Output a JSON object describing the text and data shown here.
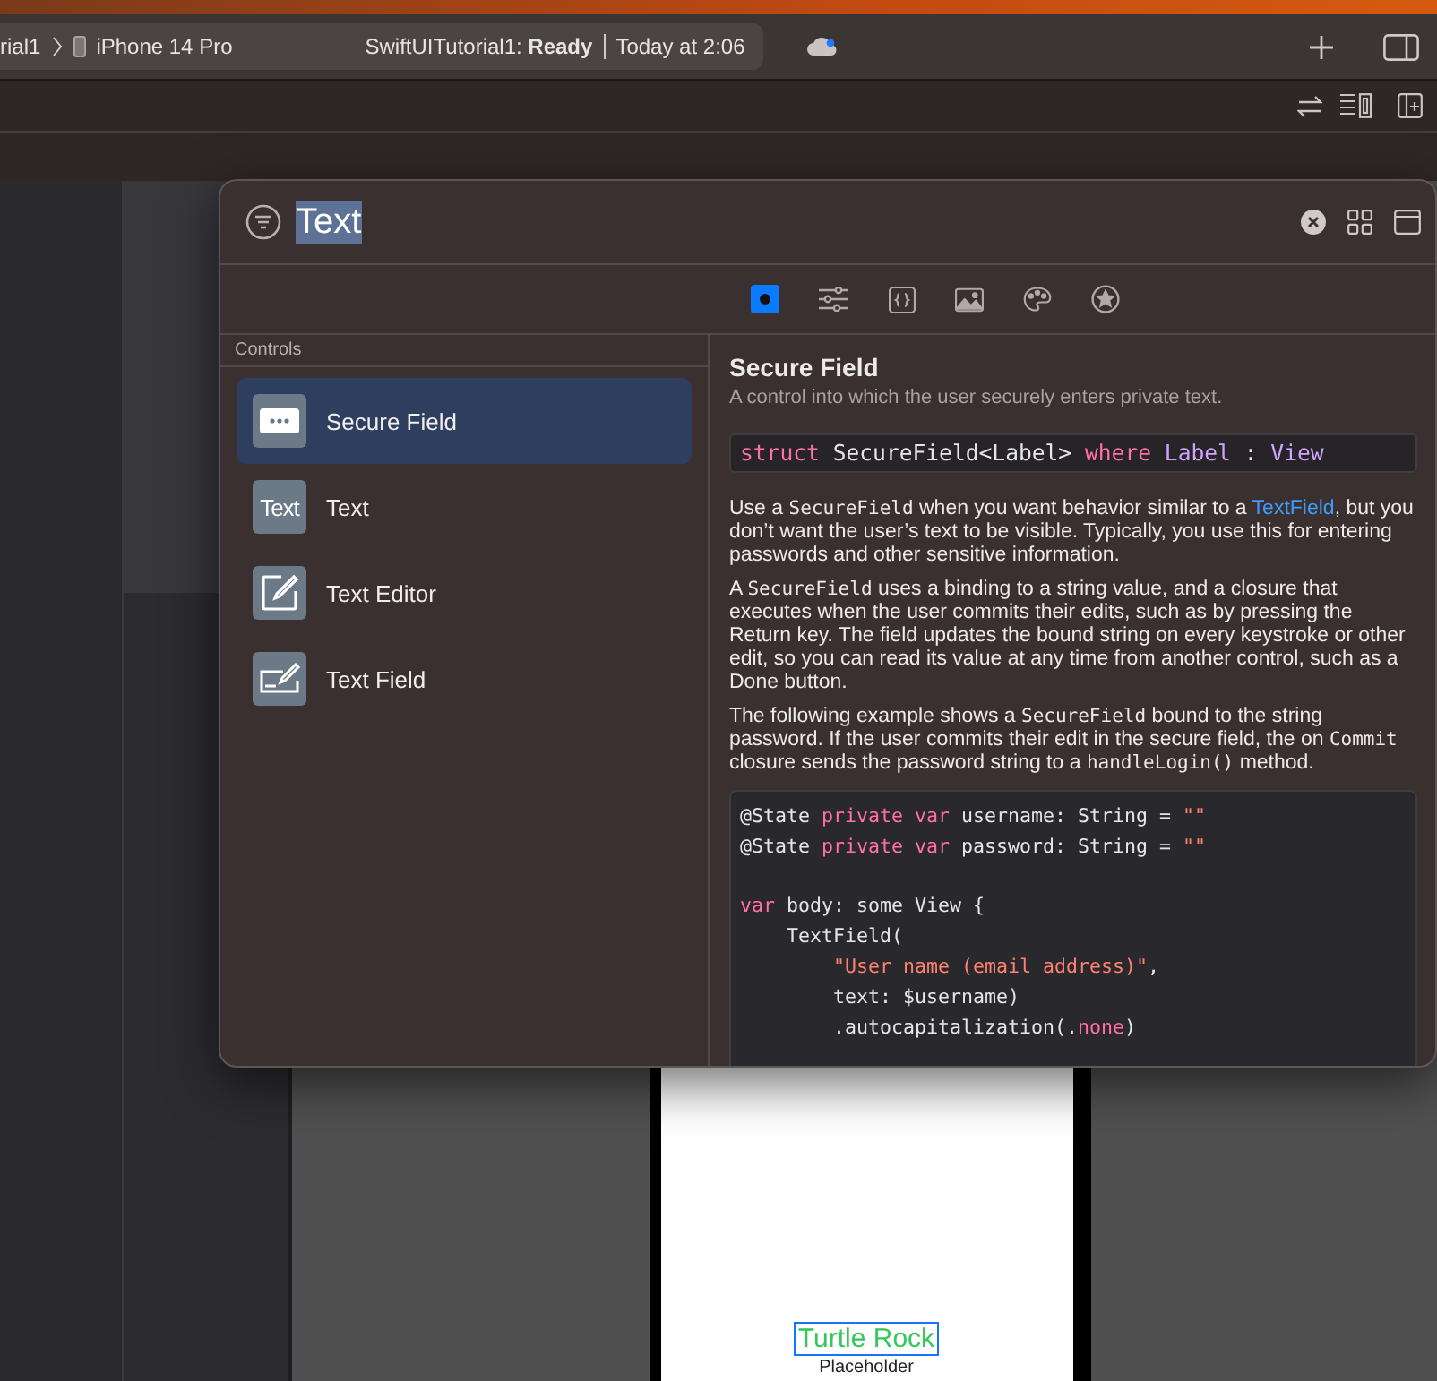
{
  "toolbar": {
    "scheme": "rial1",
    "device": "iPhone 14 Pro",
    "status": "SwiftUITutorial1: **Ready**",
    "time": "Today at 2:06"
  },
  "library": {
    "search": {
      "value": "Text"
    },
    "tabs": [
      {
        "selected": true
      },
      {
        "selected": false
      },
      {
        "selected": false
      },
      {
        "selected": false
      },
      {
        "selected": false
      },
      {
        "selected": false
      }
    ],
    "section": "Controls",
    "items": [
      {
        "label": "Secure Field",
        "selected": true
      },
      {
        "label": "Text",
        "selected": false,
        "icon_text": "Text"
      },
      {
        "label": "Text Editor",
        "selected": false
      },
      {
        "label": "Text Field",
        "selected": false
      }
    ],
    "detail": {
      "title": "Secure Field",
      "summary": "A control into which the user securely enters private text.",
      "declaration": [
        {
          "kind": "keyword",
          "text": "struct"
        },
        {
          "kind": "plain",
          "text": " SecureField<Label> "
        },
        {
          "kind": "keyword",
          "text": "where"
        },
        {
          "kind": "type",
          "text": " Label"
        },
        {
          "kind": "plain",
          "text": " : "
        },
        {
          "kind": "type",
          "text": "View"
        }
      ],
      "paragraphs": [
        [
          {
            "kind": "text",
            "text": "Use a "
          },
          {
            "kind": "code",
            "text": "SecureField"
          },
          {
            "kind": "text",
            "text": " when you want behavior similar to a "
          },
          {
            "kind": "link",
            "text": "TextField"
          },
          {
            "kind": "text",
            "text": ", but you don’t want the user’s text to be visible. Typically, you use this for entering passwords and other sensitive information."
          }
        ],
        [
          {
            "kind": "text",
            "text": "A "
          },
          {
            "kind": "code",
            "text": "SecureField"
          },
          {
            "kind": "text",
            "text": " uses a binding to a string value, and a closure that executes when the user commits their edits, such as by pressing the Return key. The field updates the bound string on every keystroke or other edit, so you can read its value at any time from another control, such as a Done button."
          }
        ],
        [
          {
            "kind": "text",
            "text": "The following example shows a "
          },
          {
            "kind": "code",
            "text": "SecureField"
          },
          {
            "kind": "text",
            "text": " bound to the string password. If the user commits their edit in the secure field, the on "
          },
          {
            "kind": "code",
            "text": "Commit"
          },
          {
            "kind": "text",
            "text": " closure sends the password string to a "
          },
          {
            "kind": "code",
            "text": "handleLogin()"
          },
          {
            "kind": "text",
            "text": " method."
          }
        ]
      ],
      "code": [
        [
          {
            "kind": "plain",
            "text": "@State "
          },
          {
            "kind": "keyword",
            "text": "private var"
          },
          {
            "kind": "plain",
            "text": " username: String = "
          },
          {
            "kind": "string",
            "text": "\"\""
          }
        ],
        [
          {
            "kind": "plain",
            "text": "@State "
          },
          {
            "kind": "keyword",
            "text": "private var"
          },
          {
            "kind": "plain",
            "text": " password: String = "
          },
          {
            "kind": "string",
            "text": "\"\""
          }
        ],
        [
          {
            "kind": "blank"
          }
        ],
        [
          {
            "kind": "keyword",
            "text": "var"
          },
          {
            "kind": "plain",
            "text": " body: some View {"
          }
        ],
        [
          {
            "kind": "plain",
            "text": "    TextField("
          }
        ],
        [
          {
            "kind": "string",
            "text": "        \"User name (email address)\""
          },
          {
            "kind": "plain",
            "text": ","
          }
        ],
        [
          {
            "kind": "plain",
            "text": "        text: $username)"
          }
        ],
        [
          {
            "kind": "plain",
            "text": "        .autocapitalization(."
          },
          {
            "kind": "keyword",
            "text": "none"
          },
          {
            "kind": "plain",
            "text": ")"
          }
        ]
      ]
    }
  },
  "preview": {
    "title": "Turtle Rock",
    "subtitle": "Placeholder"
  }
}
